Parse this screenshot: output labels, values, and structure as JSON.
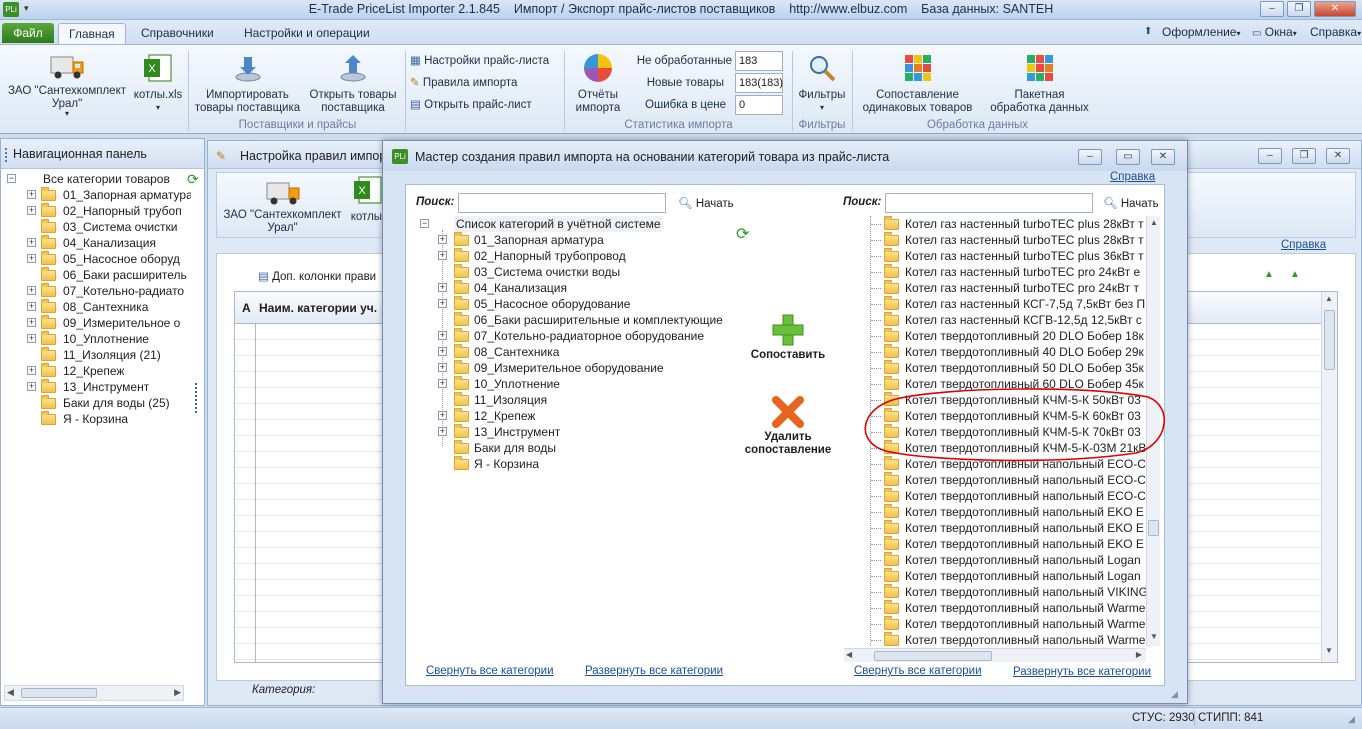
{
  "titlebar": {
    "title": "E-Trade PriceList Importer 2.1.845    Импорт / Экспорт прайс-листов поставщиков    http://www.elbuz.com    База данных: SANTEH"
  },
  "tabs": {
    "file": "Файл",
    "main": "Главная",
    "refs": "Справочники",
    "settings": "Настройки и операции"
  },
  "rightmenu": {
    "design": "Оформление",
    "windows": "Окна",
    "help": "Справка"
  },
  "ribbon": {
    "supplier": "ЗАО \"Сантехкомплект\nУрал\"",
    "file": "котлы.xls",
    "import_goods": "Импортировать\nтовары поставщика",
    "open_goods": "Открыть товары\nпоставщика",
    "group1": "Поставщики и прайсы",
    "pricelist_settings": "Настройки прайс-листа",
    "import_rules": "Правила импорта",
    "open_pricelist": "Открыть прайс-лист",
    "reports": "Отчёты\nимпорта",
    "not_processed_label": "Не обработанные",
    "not_processed": "183",
    "new_goods_label": "Новые товары",
    "new_goods": "183(183)",
    "price_error_label": "Ошибка в цене",
    "price_error": "0",
    "group2": "Статистика импорта",
    "filters": "Фильтры",
    "group3": "Фильтры",
    "compare_same": "Сопоставление\nодинаковых товаров",
    "batch": "Пакетная\nобработка данных",
    "group4": "Обработка данных"
  },
  "nav": {
    "header": "Навигационная панель",
    "root": "Все категории товаров",
    "items": [
      "01_Запорная арматура",
      "02_Напорный трубоп",
      "03_Система очистки",
      "04_Канализация",
      "05_Насосное оборуд",
      "06_Баки расширитель",
      "07_Котельно-радиато",
      "08_Сантехника",
      "09_Измерительное о",
      "10_Уплотнение",
      "11_Изоляция (21)",
      "12_Крепеж",
      "13_Инструмент",
      "Баки для воды (25)",
      "Я - Корзина"
    ]
  },
  "bgwin": {
    "title": "Настройка правил импорт",
    "supplier": "ЗАО \"Сантехкомплект\nУрал\"",
    "file": "котлы.",
    "help": "Справка",
    "extra_cols": "Доп. колонки прави",
    "col_a": "A",
    "col_name": "Наим. категории уч.",
    "category_label": "Категория:"
  },
  "wizard": {
    "title": "Мастер создания правил импорта на основании категорий товара из прайс-листа",
    "help": "Справка",
    "search_label": "Поиск:",
    "search_btn": "Начать",
    "left_root": "Список категорий в учётной системе",
    "left_items": [
      "01_Запорная арматура",
      "02_Напорный трубопровод",
      "03_Система очистки воды",
      "04_Канализация",
      "05_Насосное оборудование",
      "06_Баки расширительные и комплектующие",
      "07_Котельно-радиаторное оборудование",
      "08_Сантехника",
      "09_Измерительное оборудование",
      "10_Уплотнение",
      "11_Изоляция",
      "12_Крепеж",
      "13_Инструмент",
      "Баки для воды",
      "Я - Корзина"
    ],
    "compare": "Сопоставить",
    "delete_compare": "Удалить\nсопоставление",
    "right_items": [
      "Котел газ настенный turboTEC plus 28кВт т",
      "Котел газ настенный turboTEC plus 28кВт т",
      "Котел газ настенный turboTEC plus 36кВт т",
      "Котел газ настенный turboTEC pro 24кВт е",
      "Котел газ настенный turboTEC pro 24кВт т",
      "Котел газ настенный КСГ-7,5д 7,5кВт без П",
      "Котел газ настенный КСГВ-12,5д 12,5кВт с",
      "Котел твердотопливный 20 DLO Бобер 18к",
      "Котел твердотопливный 40 DLO Бобер 29к",
      "Котел твердотопливный 50 DLO Бобер 35к",
      "Котел твердотопливный 60 DLO Бобер 45к",
      "Котел твердотопливный КЧМ-5-К 50кВт 03",
      "Котел твердотопливный КЧМ-5-К 60кВт 03",
      "Котел твердотопливный КЧМ-5-К 70кВт 03",
      "Котел твердотопливный КЧМ-5-К-03М 21кВ",
      "Котел твердотопливный напольный ECO-C",
      "Котел твердотопливный напольный ECO-C",
      "Котел твердотопливный напольный ECO-C",
      "Котел твердотопливный напольный EKO E",
      "Котел твердотопливный напольный EKO E",
      "Котел твердотопливный напольный EKO E",
      "Котел твердотопливный напольный Logan",
      "Котел твердотопливный напольный Logan",
      "Котел твердотопливный напольный VIKING",
      "Котел твердотопливный напольный Warme",
      "Котел твердотопливный напольный Warme",
      "Котел твердотопливный напольный Warme"
    ],
    "collapse_all": "Свернуть все категории",
    "expand_all": "Развернуть все категории"
  },
  "status": {
    "stus": "СТУС: 2930",
    "stipp": "СТИПП: 841"
  },
  "colors": {
    "accent": "#2e7b1c",
    "link": "#1a4f9c",
    "highlight_oval": "#e00000"
  }
}
